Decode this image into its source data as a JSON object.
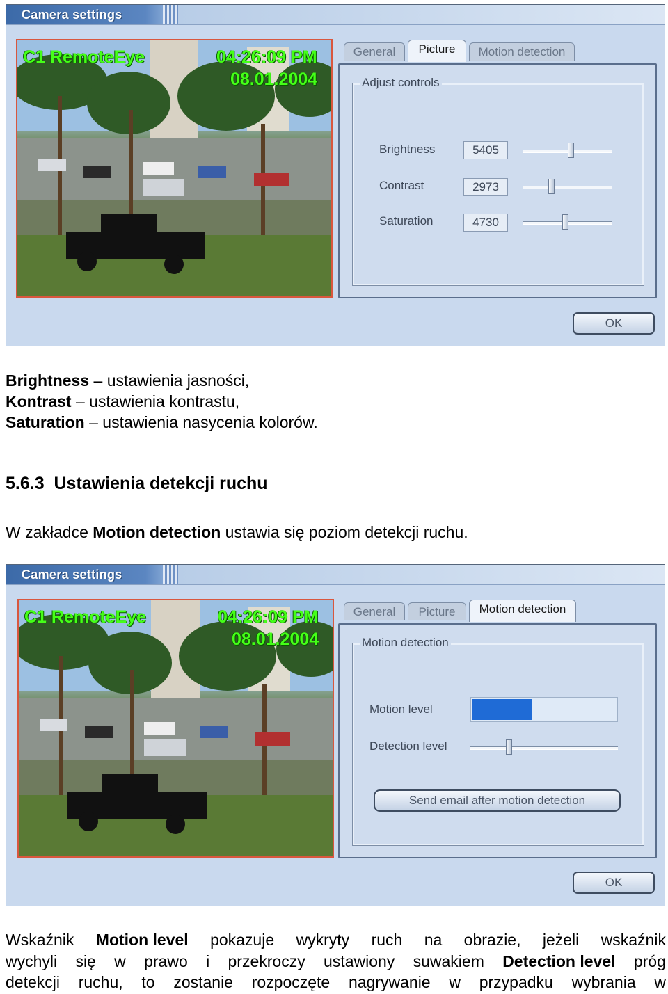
{
  "dialog1": {
    "title": "Camera settings",
    "osd": {
      "name": "C1 RemoteEye",
      "time": "04:26:09 PM",
      "date": "08.01.2004"
    },
    "tabs": [
      "General",
      "Picture",
      "Motion detection"
    ],
    "active_tab": "Picture",
    "group_title": "Adjust controls",
    "controls": [
      {
        "label": "Brightness",
        "value": "5405",
        "level": 0.54
      },
      {
        "label": "Contrast",
        "value": "2973",
        "level": 0.3
      },
      {
        "label": "Saturation",
        "value": "4730",
        "level": 0.47
      }
    ],
    "ok_label": "OK"
  },
  "text1": {
    "l1_bold": "Brightness",
    "l1_rest": " – ustawienia jasności,",
    "l2_bold": "Kontrast",
    "l2_rest": " – ustawienia kontrastu,",
    "l3_bold": "Saturation",
    "l3_rest": " – ustawienia nasycenia kolorów."
  },
  "heading": "5.6.3  Ustawienia detekcji ruchu",
  "para1": {
    "pre": "W zakładce ",
    "bold": "Motion detection",
    "post": " ustawia się poziom detekcji ruchu."
  },
  "dialog2": {
    "title": "Camera settings",
    "osd": {
      "name": "C1 RemoteEye",
      "time": "04:26:09 PM",
      "date": "08.01.2004"
    },
    "tabs": [
      "General",
      "Picture",
      "Motion detection"
    ],
    "active_tab": "Motion detection",
    "group_title": "Motion detection",
    "motion_level_label": "Motion level",
    "motion_level": 0.41,
    "detection_level_label": "Detection level",
    "detection_level": 0.25,
    "email_button": "Send email after motion detection",
    "ok_label": "OK"
  },
  "para2": {
    "l1": [
      "Wskaźnik",
      "Motion level",
      "pokazuje",
      "wykryty",
      "ruch",
      "na",
      "obrazie,",
      "jeżeli",
      "wskaźnik"
    ],
    "l2": [
      "wychyli",
      "się",
      "w",
      "prawo",
      "i",
      "przekroczy",
      "ustawiony",
      "suwakiem",
      "Detection level",
      "próg"
    ],
    "l3": [
      "detekcji",
      "ruchu,",
      "to",
      "zostanie",
      "rozpoczęte",
      "nagrywanie",
      "w",
      "przypadku",
      "wybrania",
      "w"
    ]
  }
}
